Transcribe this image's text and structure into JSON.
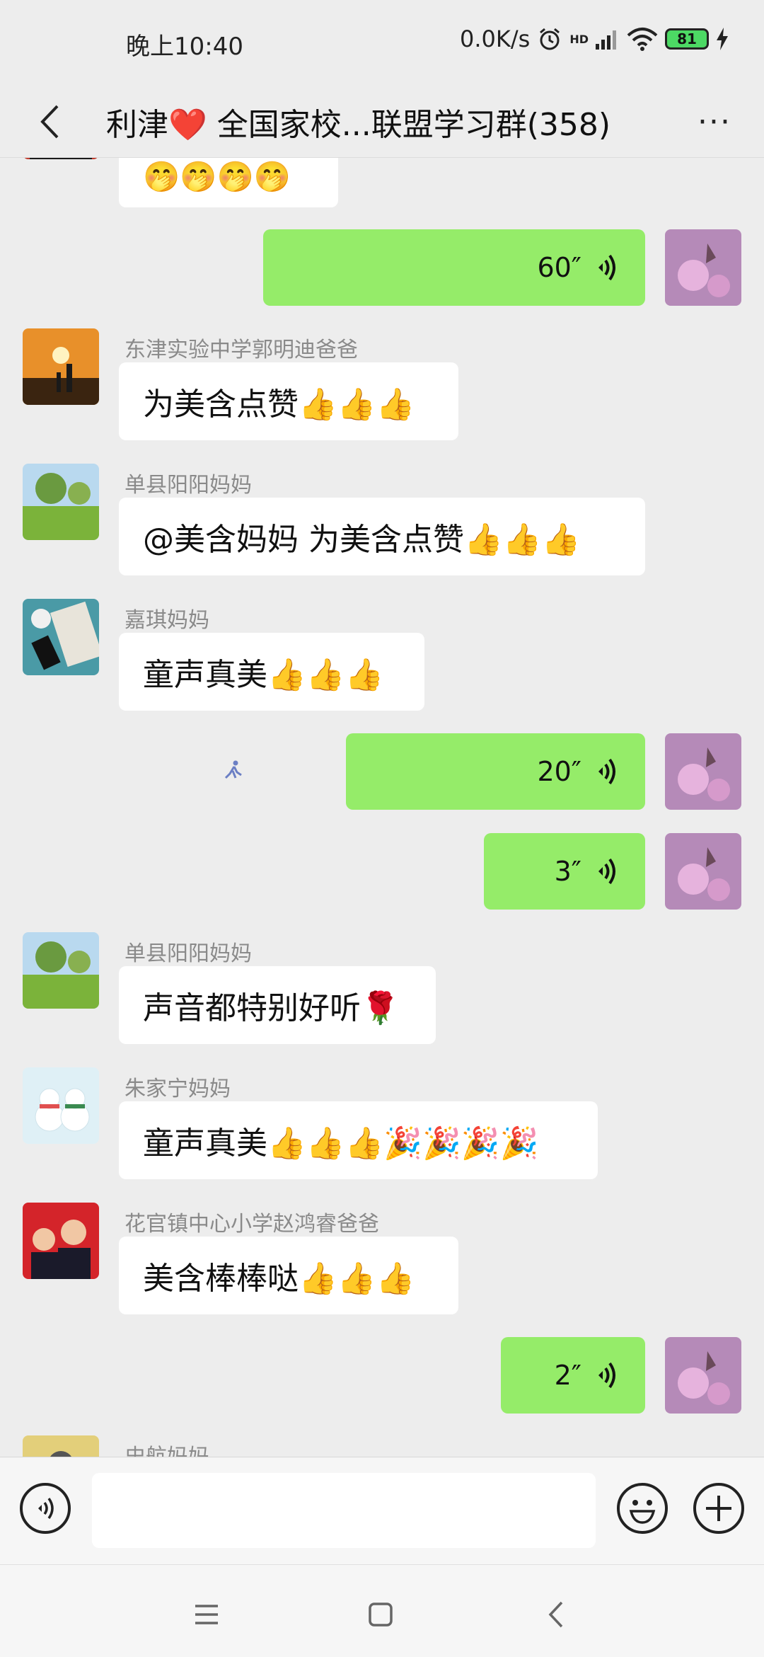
{
  "status_bar": {
    "time": "晚上10:40",
    "network_speed": "0.0K/s",
    "hd_label": "HD",
    "battery": "81"
  },
  "header": {
    "title": "利津❤️ 全国家校...联盟学习群(358)",
    "more": "···"
  },
  "messages": [
    {
      "type": "text",
      "side": "left",
      "text": "🤭🤭🤭🤭",
      "partial": true
    },
    {
      "type": "voice",
      "side": "right",
      "duration": "60″"
    },
    {
      "type": "text",
      "side": "left",
      "sender": "东津实验中学郭明迪爸爸",
      "text": "为美含点赞👍👍👍"
    },
    {
      "type": "text",
      "side": "left",
      "sender": "单县阳阳妈妈",
      "text": "@美含妈妈  为美含点赞👍👍👍"
    },
    {
      "type": "text",
      "side": "left",
      "sender": "嘉琪妈妈",
      "text": "童声真美👍👍👍"
    },
    {
      "type": "voice",
      "side": "right",
      "duration": "20″"
    },
    {
      "type": "voice",
      "side": "right",
      "duration": "3″"
    },
    {
      "type": "text",
      "side": "left",
      "sender": "单县阳阳妈妈",
      "text": "声音都特别好听🌹"
    },
    {
      "type": "text",
      "side": "left",
      "sender": "朱家宁妈妈",
      "text": "童声真美👍👍👍🎉🎉🎉🎉"
    },
    {
      "type": "text",
      "side": "left",
      "sender": "花官镇中心小学赵鸿睿爸爸",
      "text": "美含棒棒哒👍👍👍"
    },
    {
      "type": "voice",
      "side": "right",
      "duration": "2″"
    },
    {
      "type": "text",
      "side": "left",
      "sender": "史航妈妈",
      "partial": true
    }
  ],
  "input": {
    "placeholder": ""
  },
  "colors": {
    "background": "#ededed",
    "my_bubble": "#95ec69",
    "their_bubble": "#ffffff",
    "sender_name": "#8a8a8a"
  }
}
